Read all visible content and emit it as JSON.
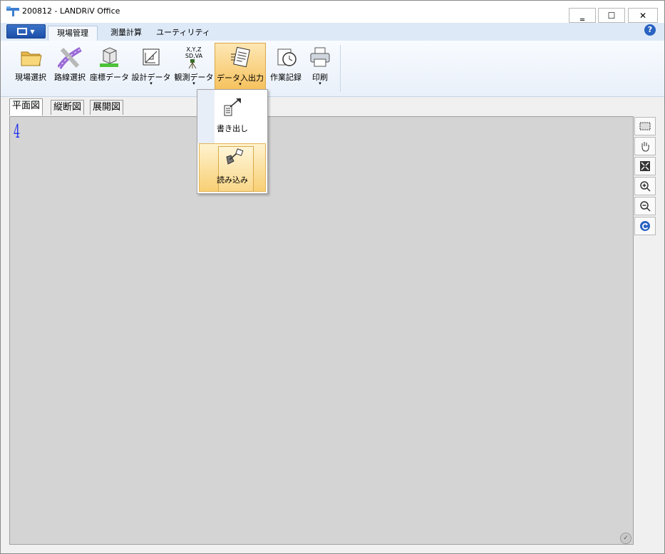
{
  "window": {
    "title": "200812 - LANDRiV Office",
    "minimize_glyph": "‗",
    "maximize_glyph": "☐",
    "close_glyph": "✕"
  },
  "ribbon_tabs": [
    {
      "label": "現場管理",
      "active": true
    },
    {
      "label": "測量計算",
      "active": false
    },
    {
      "label": "ユーティリティ",
      "active": false
    }
  ],
  "help_glyph": "?",
  "ribbon_buttons": [
    {
      "label": "現場選択",
      "icon": "folder-icon",
      "dropdown": false
    },
    {
      "label": "路線選択",
      "icon": "road-icon",
      "dropdown": false
    },
    {
      "label": "座標データ",
      "icon": "cube-icon",
      "dropdown": false
    },
    {
      "label": "設計データ",
      "icon": "drafting-icon",
      "dropdown": true
    },
    {
      "label": "観測データ",
      "icon": "survey-instrument-icon",
      "dropdown": true,
      "icon_text_1": "X,Y,Z",
      "icon_text_2": "SD,VA"
    },
    {
      "label": "データ入出力",
      "icon": "data-io-icon",
      "dropdown": true,
      "pressed": true
    },
    {
      "label": "作業記録",
      "icon": "stopwatch-icon",
      "dropdown": false
    },
    {
      "label": "印刷",
      "icon": "printer-icon",
      "dropdown": true
    }
  ],
  "dropdown_caret": "▾",
  "view_tabs": [
    {
      "label": "平面図",
      "active": true
    },
    {
      "label": "縦断図",
      "active": false
    },
    {
      "label": "展開図",
      "active": false
    }
  ],
  "canvas": {
    "background": "#d4d4d4",
    "coord_mark": "4"
  },
  "data_io_menu": {
    "items": [
      {
        "label": "書き出し",
        "icon": "export-icon",
        "highlighted": false
      },
      {
        "label": "読み込み",
        "icon": "import-icon",
        "highlighted": true
      }
    ]
  },
  "right_toolbar": [
    {
      "icon": "select-rectangle-icon"
    },
    {
      "icon": "pan-hand-icon"
    },
    {
      "icon": "fit-extent-icon"
    },
    {
      "icon": "zoom-in-icon"
    },
    {
      "icon": "zoom-out-icon"
    },
    {
      "icon": "refresh-icon"
    }
  ],
  "colors": {
    "accent": "#2a63c1",
    "pressed": "#f6c25e",
    "ribbon_tab_bg": "#dde9f7"
  }
}
